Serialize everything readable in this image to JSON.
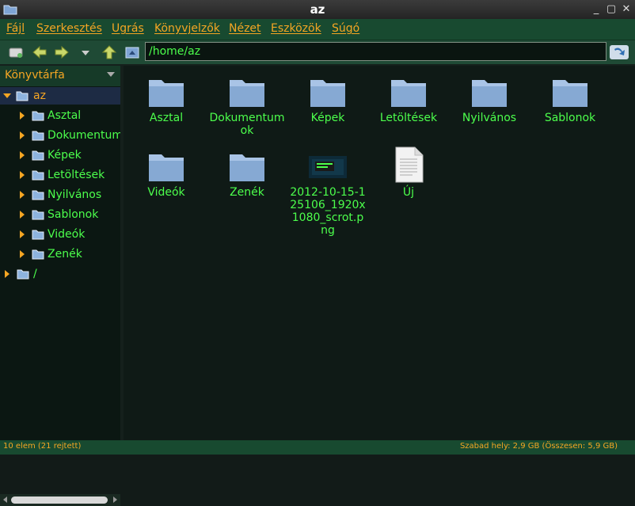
{
  "window": {
    "title": "az"
  },
  "menu": [
    "Fájl",
    "Szerkesztés",
    "Ugrás",
    "Könyvjelzők",
    "Nézet",
    "Eszközök",
    "Súgó"
  ],
  "path": "/home/az",
  "sidebar": {
    "header": "Könyvtárfa",
    "tree": [
      {
        "label": "az",
        "depth": 0,
        "expanded": true,
        "selected": true
      },
      {
        "label": "Asztal",
        "depth": 1
      },
      {
        "label": "Dokumentumok",
        "depth": 1
      },
      {
        "label": "Képek",
        "depth": 1
      },
      {
        "label": "Letöltések",
        "depth": 1
      },
      {
        "label": "Nyilvános",
        "depth": 1
      },
      {
        "label": "Sablonok",
        "depth": 1
      },
      {
        "label": "Videók",
        "depth": 1
      },
      {
        "label": "Zenék",
        "depth": 1
      },
      {
        "label": "/",
        "depth": 0
      }
    ]
  },
  "files": [
    {
      "name": "Asztal",
      "type": "folder"
    },
    {
      "name": "Dokumentumok",
      "type": "folder"
    },
    {
      "name": "Képek",
      "type": "folder"
    },
    {
      "name": "Letöltések",
      "type": "folder"
    },
    {
      "name": "Nyilvános",
      "type": "folder"
    },
    {
      "name": "Sablonok",
      "type": "folder"
    },
    {
      "name": "Videók",
      "type": "folder"
    },
    {
      "name": "Zenék",
      "type": "folder"
    },
    {
      "name": "2012-10-15-125106_1920x1080_scrot.png",
      "type": "image"
    },
    {
      "name": "Új",
      "type": "document"
    }
  ],
  "status": {
    "left": "10 elem (21 rejtett)",
    "right": "Szabad hely: 2,9 GB (Összesen: 5,9 GB)"
  },
  "colors": {
    "accent": "#f5a623",
    "text": "#4cff4c",
    "menubar": "#184a30"
  }
}
